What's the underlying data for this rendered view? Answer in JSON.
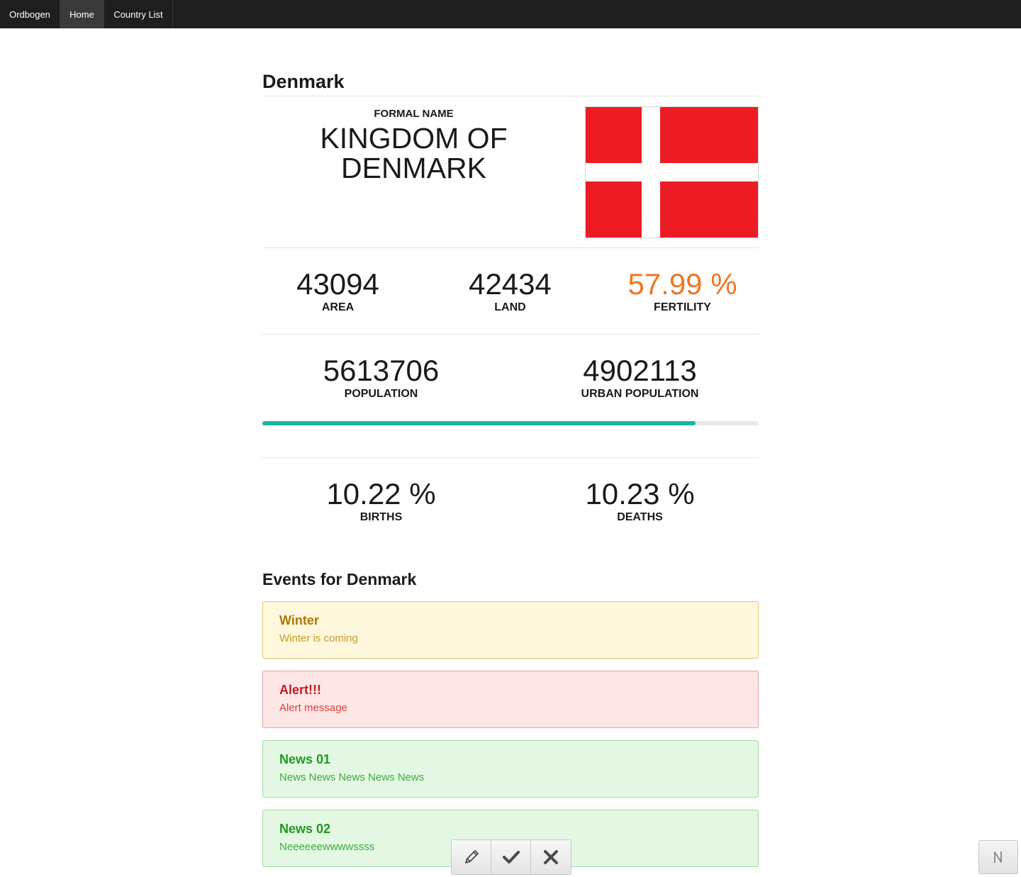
{
  "navbar": {
    "brand": "Ordbogen",
    "items": [
      {
        "label": "Home",
        "active": true
      },
      {
        "label": "Country List",
        "active": false
      }
    ]
  },
  "country": {
    "title": "Denmark",
    "formal_label": "FORMAL NAME",
    "formal_name_line1": "KINGDOM OF",
    "formal_name_line2": "DENMARK",
    "flag": {
      "field_color": "#ed1c24",
      "cross_color": "#ffffff"
    }
  },
  "stats": {
    "area": {
      "value": "43094",
      "label": "AREA"
    },
    "land": {
      "value": "42434",
      "label": "LAND"
    },
    "fertility": {
      "value": "57.99 %",
      "label": "FERTILITY",
      "color": "#ef7623"
    },
    "population": {
      "value": "5613706",
      "label": "POPULATION"
    },
    "urban_population": {
      "value": "4902113",
      "label": "URBAN POPULATION"
    },
    "urban_ratio": 0.873,
    "births": {
      "value": "10.22 %",
      "label": "BIRTHS"
    },
    "deaths": {
      "value": "10.23 %",
      "label": "DEATHS"
    }
  },
  "events": {
    "title": "Events for Denmark",
    "items": [
      {
        "title": "Winter",
        "message": "Winter is coming",
        "type": "warning"
      },
      {
        "title": "Alert!!!",
        "message": "Alert message",
        "type": "danger"
      },
      {
        "title": "News 01",
        "message": "News News News News News",
        "type": "success"
      },
      {
        "title": "News 02",
        "message": "Neeeeeewwwwssss",
        "type": "success"
      }
    ]
  },
  "toolbar": {
    "buttons": [
      {
        "icon": "pencil-icon"
      },
      {
        "icon": "checkmark-icon"
      },
      {
        "icon": "close-icon"
      }
    ]
  },
  "corner_button": {
    "icon": "n-logo-icon"
  },
  "colors": {
    "navbar_bg": "#1e1e1e",
    "accent_teal": "#1ab5a8",
    "fertility_orange": "#ef7623"
  }
}
